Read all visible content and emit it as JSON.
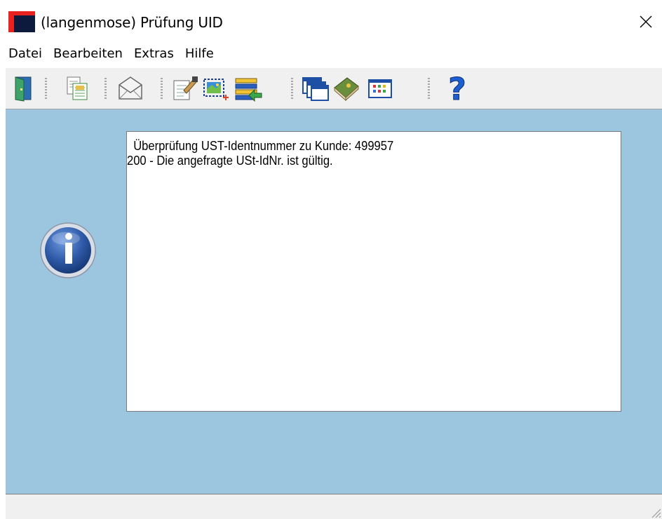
{
  "window": {
    "title": "(langenmose) Prüfung UID",
    "close_symbol": "✕"
  },
  "menu": {
    "items": [
      {
        "label": "Datei"
      },
      {
        "label": "Bearbeiten"
      },
      {
        "label": "Extras"
      },
      {
        "label": "Hilfe"
      }
    ]
  },
  "toolbar": {
    "icons": [
      "exit-door-icon",
      "copy-document-icon",
      "email-envelope-icon",
      "edit-document-icon",
      "select-area-icon",
      "import-list-icon",
      "windows-cascade-icon",
      "book-icon",
      "grid-table-icon",
      "help-question-icon"
    ]
  },
  "message": {
    "line1": "Überprüfung UST-Identnummer zu Kunde: 499957",
    "line2": "200 - Die angefragte USt-IdNr. ist gültig."
  },
  "colors": {
    "client_background": "#9cc6df",
    "toolbar_background": "#f0f0f0",
    "app_icon_red": "#e8231f",
    "app_icon_navy": "#0d1a3e",
    "info_icon_blue": "#2f5aa8"
  }
}
